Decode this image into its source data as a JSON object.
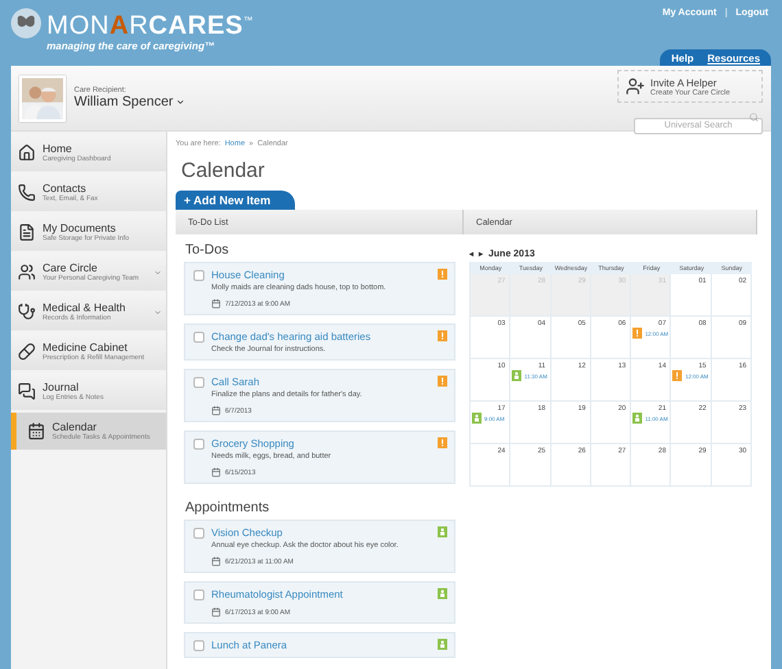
{
  "header": {
    "logo_prefix": "MON",
    "logo_accent": "A",
    "logo_middle": "R",
    "logo_suffix": "CARES",
    "logo_tm": "™",
    "tagline": "managing the care of caregiving™",
    "links": [
      "My Account",
      "Logout"
    ],
    "link_separator": "|",
    "tabs": [
      {
        "label": "Help",
        "selected": false
      },
      {
        "label": "Resources",
        "selected": true
      }
    ]
  },
  "recipient": {
    "label": "Care Recipient:",
    "name": "William Spencer"
  },
  "invite": {
    "title": "Invite A Helper",
    "subtitle": "Create Your Care Circle"
  },
  "search": {
    "placeholder": "Universal Search"
  },
  "sidebar": {
    "items": [
      {
        "label": "Home",
        "sub": "Caregiving Dashboard",
        "selected": false,
        "has_menu": false
      },
      {
        "label": "Contacts",
        "sub": "Text, Email, & Fax",
        "selected": false,
        "has_menu": false
      },
      {
        "label": "My Documents",
        "sub": "Safe Storage for Private Info",
        "selected": false,
        "has_menu": false
      },
      {
        "label": "Care Circle",
        "sub": "Your Personal Caregiving Team",
        "selected": false,
        "has_menu": true
      },
      {
        "label": "Medical & Health",
        "sub": "Records & Information",
        "selected": false,
        "has_menu": true
      },
      {
        "label": "Medicine Cabinet",
        "sub": "Prescription & Refill Management",
        "selected": false,
        "has_menu": false
      },
      {
        "label": "Journal",
        "sub": "Log Entries & Notes",
        "selected": false,
        "has_menu": false
      },
      {
        "label": "Calendar",
        "sub": "Schedule Tasks & Appointments",
        "selected": true,
        "has_menu": false
      }
    ]
  },
  "breadcrumb": {
    "prefix": "You are here:",
    "link": "Home",
    "separator": "»",
    "current": "Calendar"
  },
  "page_title": "Calendar",
  "add_button": "+ Add New Item",
  "columns": [
    "To-Do List",
    "Calendar"
  ],
  "sections": [
    {
      "title": "To-Dos",
      "items": [
        {
          "kind": "todo",
          "title": "House Cleaning",
          "note": "Molly maids are cleaning dads house, top to bottom.",
          "date": "7/12/2013 at 9:00 AM",
          "checked": false
        },
        {
          "kind": "todo",
          "title": "Change dad's hearing aid batteries",
          "note": "Check the Journal for instructions.",
          "checked": false
        },
        {
          "kind": "todo",
          "title": "Call Sarah",
          "note": "Finalize the plans and details for father's day.",
          "date": "6/7/2013",
          "checked": false
        },
        {
          "kind": "todo",
          "title": "Grocery Shopping",
          "note": "Needs milk, eggs, bread, and butter",
          "date": "6/15/2013",
          "checked": false
        }
      ]
    },
    {
      "title": "Appointments",
      "items": [
        {
          "kind": "appointment",
          "title": "Vision Checkup",
          "note": "Annual eye checkup. Ask the doctor about his eye color.",
          "date": "6/21/2013 at 11:00 AM",
          "checked": false
        },
        {
          "kind": "appointment",
          "title": "Rheumatologist Appointment",
          "date": "6/17/2013 at 9:00 AM",
          "checked": false
        },
        {
          "kind": "appointment",
          "title": "Lunch at Panera",
          "checked": false
        }
      ]
    }
  ],
  "calendar": {
    "prev": "◂",
    "next": "▸",
    "month": "June 2013",
    "weekdays": [
      "Monday",
      "Tuesday",
      "Wednesday",
      "Thursday",
      "Friday",
      "Saturday",
      "Sunday"
    ],
    "weeks": [
      [
        {
          "day": "27",
          "muted": true
        },
        {
          "day": "28",
          "muted": true
        },
        {
          "day": "29",
          "muted": true
        },
        {
          "day": "30",
          "muted": true
        },
        {
          "day": "31",
          "muted": true
        },
        {
          "day": "01",
          "muted": false
        },
        {
          "day": "02",
          "muted": false
        }
      ],
      [
        {
          "day": "03",
          "muted": false
        },
        {
          "day": "04",
          "muted": false
        },
        {
          "day": "05",
          "muted": false
        },
        {
          "day": "06",
          "muted": false
        },
        {
          "day": "07",
          "muted": false,
          "events": [
            {
              "kind": "todo",
              "time": "12:00 AM"
            }
          ]
        },
        {
          "day": "08",
          "muted": false
        },
        {
          "day": "09",
          "muted": false
        }
      ],
      [
        {
          "day": "10",
          "muted": false
        },
        {
          "day": "11",
          "muted": false,
          "events": [
            {
              "kind": "appointment",
              "time": "11:30 AM"
            }
          ]
        },
        {
          "day": "12",
          "muted": false
        },
        {
          "day": "13",
          "muted": false
        },
        {
          "day": "14",
          "muted": false
        },
        {
          "day": "15",
          "muted": false,
          "events": [
            {
              "kind": "todo",
              "time": "12:00 AM"
            }
          ]
        },
        {
          "day": "16",
          "muted": false
        }
      ],
      [
        {
          "day": "17",
          "muted": false,
          "events": [
            {
              "kind": "appointment",
              "time": "9:00 AM"
            }
          ]
        },
        {
          "day": "18",
          "muted": false
        },
        {
          "day": "19",
          "muted": false
        },
        {
          "day": "20",
          "muted": false
        },
        {
          "day": "21",
          "muted": false,
          "events": [
            {
              "kind": "appointment",
              "time": "11:00 AM"
            }
          ]
        },
        {
          "day": "22",
          "muted": false
        },
        {
          "day": "23",
          "muted": false
        }
      ],
      [
        {
          "day": "24",
          "muted": false
        },
        {
          "day": "25",
          "muted": false
        },
        {
          "day": "26",
          "muted": false
        },
        {
          "day": "27",
          "muted": false
        },
        {
          "day": "28",
          "muted": false
        },
        {
          "day": "29",
          "muted": false
        },
        {
          "day": "30",
          "muted": false
        }
      ]
    ]
  }
}
